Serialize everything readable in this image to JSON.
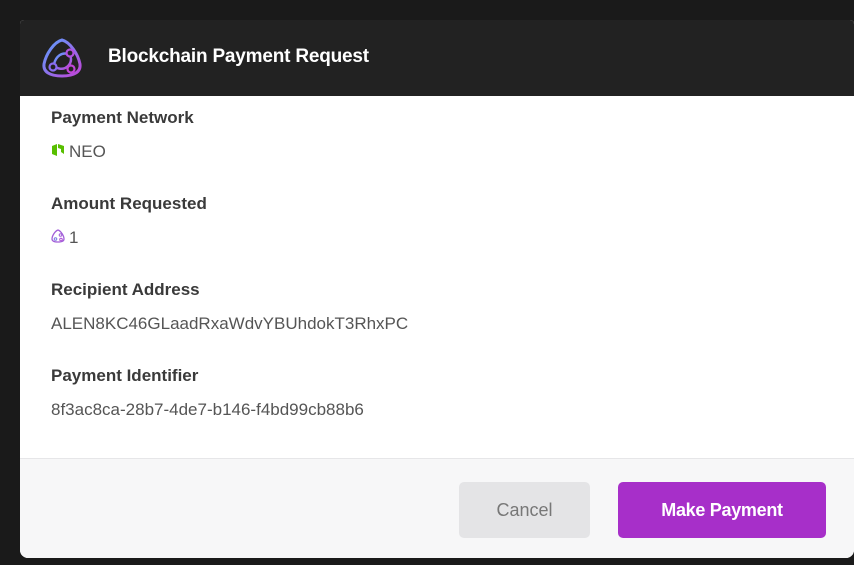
{
  "dialog": {
    "title": "Blockchain Payment Request",
    "logo_icon": "blockchain-network-icon"
  },
  "fields": {
    "network": {
      "label": "Payment Network",
      "value": "NEO",
      "icon": "neo-icon",
      "icon_color": "#58bf00"
    },
    "amount": {
      "label": "Amount Requested",
      "value": "1",
      "icon": "token-icon",
      "icon_color": "#a25fd8"
    },
    "recipient": {
      "label": "Recipient Address",
      "value": "ALEN8KC46GLaadRxaWdvYBUhdokT3RhxPC"
    },
    "identifier": {
      "label": "Payment Identifier",
      "value": "8f3ac8ca-28b7-4de7-b146-f4bd99cb88b6"
    }
  },
  "footer": {
    "cancel_label": "Cancel",
    "pay_label": "Make Payment"
  },
  "colors": {
    "header_bg": "#222222",
    "accent": "#a72fc9",
    "cancel_bg": "#e4e4e6"
  }
}
